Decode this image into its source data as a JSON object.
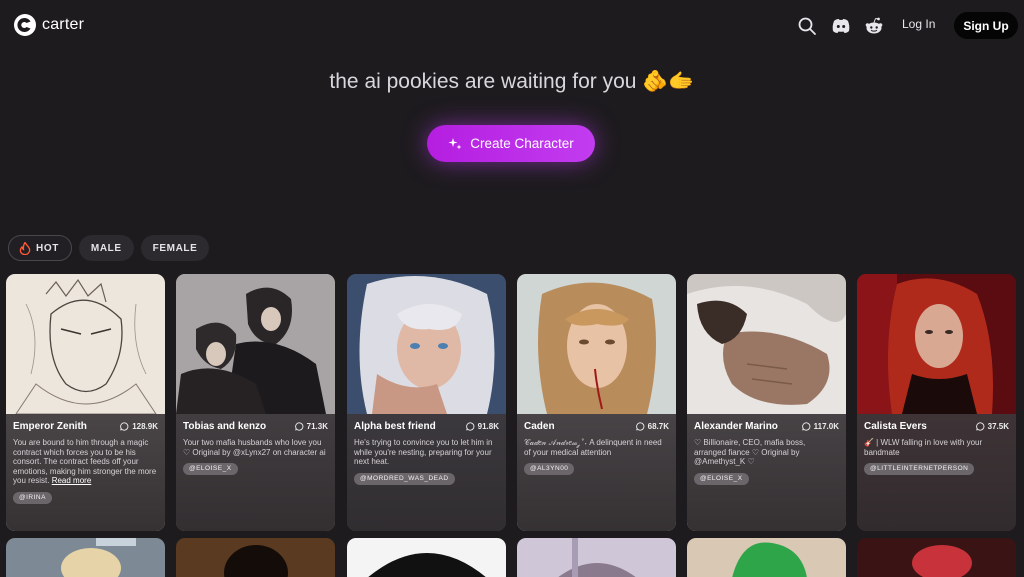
{
  "header": {
    "logo_text": "carter",
    "login_label": "Log In",
    "signup_label": "Sign Up"
  },
  "hero": {
    "tagline": "the ai pookies are waiting for you 🫵🫱",
    "create_label": "Create Character"
  },
  "filters": [
    {
      "label": "HOT",
      "icon": "flame-icon",
      "active": true
    },
    {
      "label": "MALE",
      "active": false
    },
    {
      "label": "FEMALE",
      "active": false
    }
  ],
  "cards": [
    {
      "name": "Emperor Zenith",
      "count": "128.9K",
      "desc": "You are bound to him through a magic contract which forces you to be his consort. The contract feeds off your emotions, making him stronger the more you resist.",
      "more": "Read more",
      "tag": "@IRINA"
    },
    {
      "name": "Tobias and kenzo",
      "count": "71.3K",
      "desc": "Your two mafia husbands who love you ♡ Original by @xLynx27 on character ai",
      "tag": "@ELOISE_X"
    },
    {
      "name": "Alpha best friend",
      "count": "91.8K",
      "desc": "He's trying to convince you to let him in while you're nesting, preparing for your next heat.",
      "tag": "@MORDRED_WAS_DEAD"
    },
    {
      "name": "Caden",
      "count": "68.7K",
      "desc": "𝒞𝒶𝒹𝑒𝓃 𝒜𝓃𝒹𝓇𝑒𝓌 ༘ ˚˖ A delinquent in need of your medical attention",
      "tag": "@AL3YN00"
    },
    {
      "name": "Alexander Marino",
      "count": "117.0K",
      "desc": "♡ Billionaire, CEO, mafia boss, arranged fiance ♡ Original by @Amethyst_K ♡",
      "tag": "@ELOISE_X"
    },
    {
      "name": "Calista Evers",
      "count": "37.5K",
      "desc": "🎸 | WLW falling in love with your bandmate",
      "tag": "@LITTLEINTERNETPERSON"
    }
  ],
  "colors": {
    "background": "#1d1b1e",
    "accent": "#b51ee0"
  }
}
